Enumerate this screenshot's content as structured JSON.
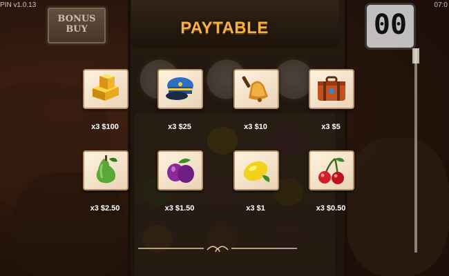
{
  "header": {
    "version": "PIN v1.0.13",
    "clock": "07:0",
    "bonus_buy_line1": "BONUS",
    "bonus_buy_line2": "BUY",
    "counter": "00",
    "title": "PAYTABLE"
  },
  "paytable": {
    "row1": [
      {
        "symbol": "gold-bars",
        "payout": "x3  $100"
      },
      {
        "symbol": "conductor-cap",
        "payout": "x3  $25"
      },
      {
        "symbol": "bell",
        "payout": "x3  $10"
      },
      {
        "symbol": "suitcase",
        "payout": "x3  $5"
      }
    ],
    "row2": [
      {
        "symbol": "pear",
        "payout": "x3  $2.50"
      },
      {
        "symbol": "plum",
        "payout": "x3  $1.50"
      },
      {
        "symbol": "lemon",
        "payout": "x3  $1"
      },
      {
        "symbol": "cherry",
        "payout": "x3  $0.50"
      }
    ]
  },
  "colors": {
    "title": "#f3b04a",
    "tile_bg": "#fff3df",
    "tile_border": "#b99068"
  }
}
